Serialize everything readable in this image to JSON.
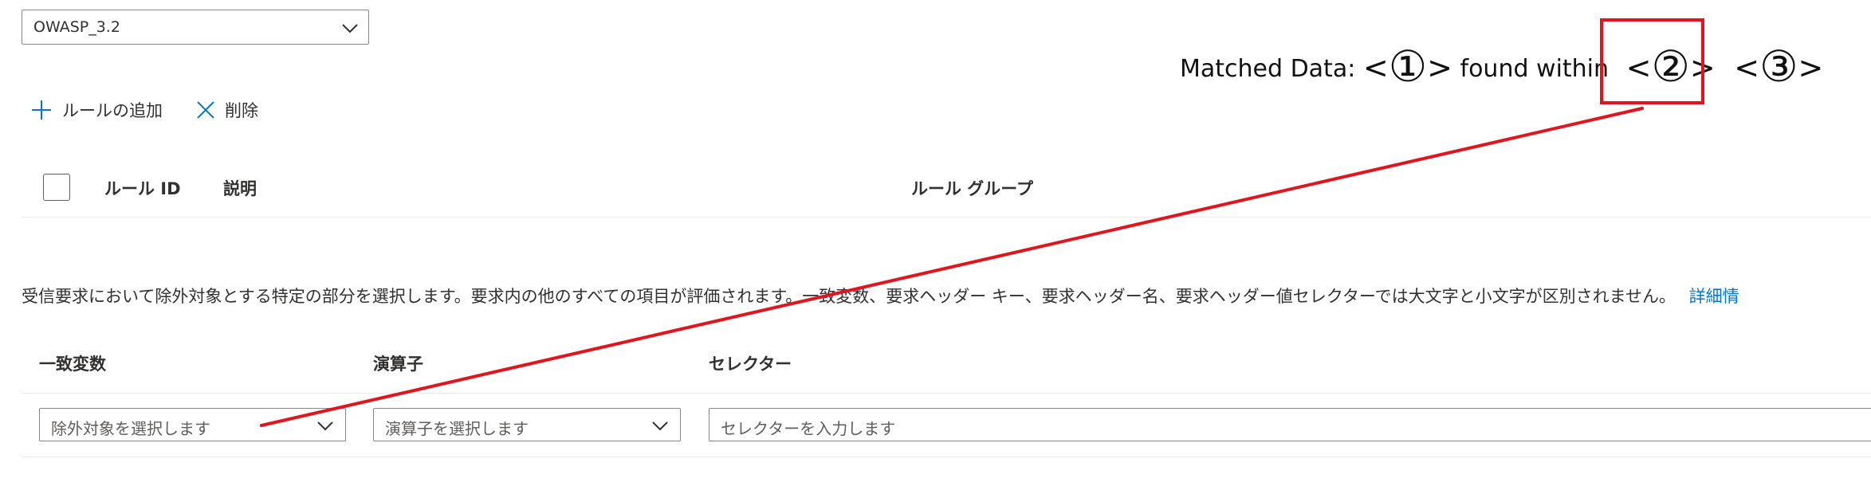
{
  "ruleset": {
    "value": "OWASP_3.2"
  },
  "toolbar": {
    "add_label": "ルールの追加",
    "delete_label": "削除"
  },
  "table": {
    "headers": {
      "rule_id": "ルール ID",
      "description": "説明",
      "rule_group": "ルール グループ"
    }
  },
  "description": {
    "text": "受信要求において除外対象とする特定の部分を選択します。要求内の他のすべての項目が評価されます。一致変数、要求ヘッダー キー、要求ヘッダー名、要求ヘッダー値セレクターでは大文字と小文字が区別されません。",
    "link": "詳細情"
  },
  "exclusion": {
    "headers": {
      "match_variable": "一致変数",
      "operator": "演算子",
      "selector": "セレクター"
    },
    "match_variable_placeholder": "除外対象を選択します",
    "operator_placeholder": "演算子を選択します",
    "selector_placeholder": "セレクターを入力します"
  },
  "annotation": {
    "prefix": "Matched Data:",
    "marker1": "①",
    "middle": "found within",
    "marker2": "②",
    "marker3": "③",
    "lt": "<",
    "gt": ">",
    "color": "#e3141c"
  },
  "icons": {
    "add": "plus-icon",
    "delete": "close-icon",
    "dropdown": "chevron-down-icon"
  },
  "colors": {
    "accent": "#0078d4",
    "border": "#8a8886",
    "annotation_red": "#e3141c"
  }
}
